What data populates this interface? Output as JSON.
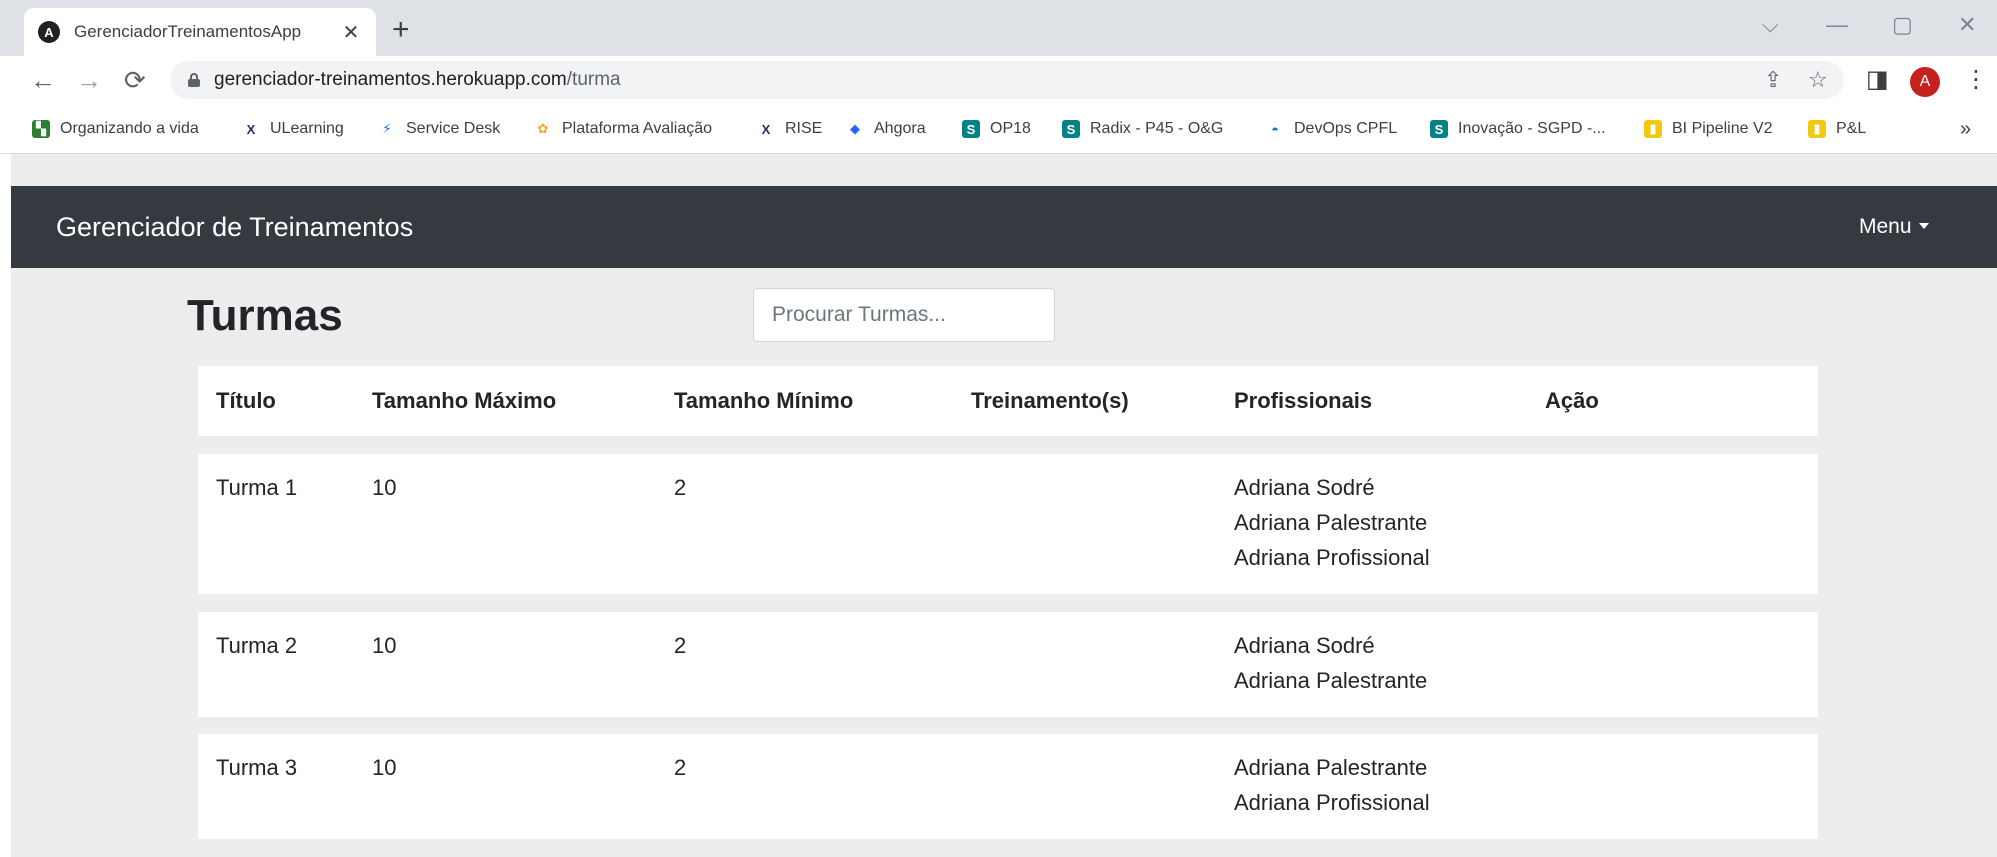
{
  "browser": {
    "tab": {
      "favicon_letter": "A",
      "title": "GerenciadorTreinamentosApp",
      "close": "✕"
    },
    "new_tab": "+",
    "window_controls": {
      "dropdown": "⌵",
      "minimize": "—",
      "restore": "▢",
      "close": "✕"
    },
    "nav": {
      "back": "←",
      "forward": "→",
      "reload": "⟳"
    },
    "address": {
      "host": "gerenciador-treinamentos.herokuapp.com",
      "path": "/turma"
    },
    "omnibox_icons": {
      "share": "⇪",
      "star": "☆"
    },
    "toolbar_icons": {
      "sidepanel": "◨",
      "kebab": "⋮"
    },
    "profile_letter": "A",
    "bookmarks": [
      {
        "label": "Organizando a vida",
        "color": "#2e7d32",
        "glyph": "▚"
      },
      {
        "label": "ULearning",
        "color": "#ffffff",
        "glyph": "X"
      },
      {
        "label": "Service Desk",
        "color": "#ffffff",
        "glyph": "⚡"
      },
      {
        "label": "Plataforma Avaliação",
        "color": "#ffffff",
        "glyph": "✿"
      },
      {
        "label": "RISE",
        "color": "#ffffff",
        "glyph": "X"
      },
      {
        "label": "Ahgora",
        "color": "#ffffff",
        "glyph": "◆"
      },
      {
        "label": "OP18",
        "color": "#038387",
        "glyph": "S"
      },
      {
        "label": "Radix - P45 - O&G",
        "color": "#038387",
        "glyph": "S"
      },
      {
        "label": "DevOps CPFL",
        "color": "#0078d4",
        "glyph": "◓"
      },
      {
        "label": "Inovação - SGPD -...",
        "color": "#038387",
        "glyph": "S"
      },
      {
        "label": "BI Pipeline V2",
        "color": "#f2c811",
        "glyph": "▮"
      },
      {
        "label": "P&L",
        "color": "#f2c811",
        "glyph": "▮"
      }
    ],
    "bookmarks_more": "»"
  },
  "app": {
    "brand": "Gerenciador de Treinamentos",
    "menu_label": "Menu"
  },
  "page": {
    "title": "Turmas",
    "search_placeholder": "Procurar Turmas..."
  },
  "table": {
    "headers": {
      "titulo": "Título",
      "tamanho_maximo": "Tamanho Máximo",
      "tamanho_minimo": "Tamanho Mínimo",
      "treinamentos": "Treinamento(s)",
      "profissionais": "Profissionais",
      "acao": "Ação"
    },
    "rows": [
      {
        "titulo": "Turma 1",
        "tamanho_maximo": "10",
        "tamanho_minimo": "2",
        "treinamentos": "",
        "profissionais": [
          "Adriana Sodré",
          "Adriana Palestrante",
          "Adriana Profissional"
        ]
      },
      {
        "titulo": "Turma 2",
        "tamanho_maximo": "10",
        "tamanho_minimo": "2",
        "treinamentos": "",
        "profissionais": [
          "Adriana Sodré",
          "Adriana Palestrante"
        ]
      },
      {
        "titulo": "Turma 3",
        "tamanho_maximo": "10",
        "tamanho_minimo": "2",
        "treinamentos": "",
        "profissionais": [
          "Adriana Palestrante",
          "Adriana Profissional"
        ]
      }
    ]
  }
}
